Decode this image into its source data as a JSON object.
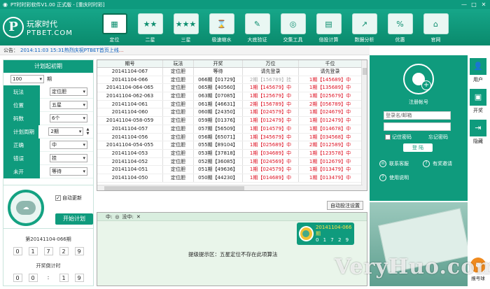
{
  "window": {
    "title": "PT时时彩软件V1.00 正式版 - [重庆时时彩]",
    "controls": [
      "—",
      "□",
      "✕"
    ]
  },
  "logo": {
    "mark": "P",
    "cn": "玩家时代",
    "en": "PTBET.COM"
  },
  "toolbar": [
    {
      "label": "定位",
      "icon": "▦"
    },
    {
      "label": "二星",
      "icon": "★★"
    },
    {
      "label": "三星",
      "icon": "★★★"
    },
    {
      "label": "极速缩水",
      "icon": "⌛"
    },
    {
      "label": "大底验证",
      "icon": "✎"
    },
    {
      "label": "交集工具",
      "icon": "◎"
    },
    {
      "label": "倍投计算",
      "icon": "▤"
    },
    {
      "label": "数据分析",
      "icon": "↗"
    },
    {
      "label": "优惠",
      "icon": "%"
    },
    {
      "label": "官网",
      "icon": "⌂"
    }
  ],
  "notice": {
    "prefix": "公告：",
    "message": "2014:11:03 15:31热烈庆祝PTBET首页上线",
    "link": "..."
  },
  "left": {
    "title": "计划起初期",
    "period_value": "100",
    "period_suffix": "期",
    "rows": [
      {
        "key": "玩法",
        "value": "定位胆"
      },
      {
        "key": "位置",
        "value": "五星"
      },
      {
        "key": "码数",
        "value": "6个"
      },
      {
        "key": "计划周期",
        "value": "2期"
      },
      {
        "key": "正确",
        "value": "中"
      },
      {
        "key": "错误",
        "value": "挂"
      },
      {
        "key": "未开",
        "value": "等待"
      }
    ],
    "auto_update": "自动更新",
    "auto_update_checked": "✓",
    "start_plan": "开始计划",
    "issue_label": "第20141104-066期",
    "issue_digits": [
      "0",
      "1",
      "7",
      "2",
      "9"
    ],
    "countdown_label": "开奖倒计时",
    "countdown_digits": [
      "0",
      "0",
      ":",
      "1",
      "9"
    ]
  },
  "table": {
    "headers": [
      "期号",
      "玩法",
      "开奖",
      "万位",
      "千位"
    ],
    "rows": [
      {
        "issue": "20141104-067",
        "play": "定位胆",
        "draw": "等待",
        "w": "请先登录",
        "q": "请先登录"
      },
      {
        "issue": "20141104-066",
        "play": "定位胆",
        "draw": "066期【01729】",
        "w": "2期【156789】挂",
        "q": "1期【145689】中"
      },
      {
        "issue": "20141104-064-065",
        "play": "定位胆",
        "draw": "065期【40560】",
        "w": "1期【145679】中",
        "q": "1期【135689】中"
      },
      {
        "issue": "20141104-062-063",
        "play": "定位胆",
        "draw": "063期【07085】",
        "w": "1期【125679】中",
        "q": "1期【025679】中"
      },
      {
        "issue": "20141104-061",
        "play": "定位胆",
        "draw": "061期【46631】",
        "w": "2期【156789】中",
        "q": "2期【056789】中"
      },
      {
        "issue": "20141104-060",
        "play": "定位胆",
        "draw": "060期【24350】",
        "w": "1期【024579】中",
        "q": "1期【024679】中"
      },
      {
        "issue": "20141104-058-059",
        "play": "定位胆",
        "draw": "059期【01376】",
        "w": "1期【012479】中",
        "q": "1期【012479】中"
      },
      {
        "issue": "20141104-057",
        "play": "定位胆",
        "draw": "057期【56509】",
        "w": "1期【014579】中",
        "q": "1期【014678】中"
      },
      {
        "issue": "20141104-056",
        "play": "定位胆",
        "draw": "056期【65071】",
        "w": "1期【345679】中",
        "q": "1期【034568】中"
      },
      {
        "issue": "20141104-054-055",
        "play": "定位胆",
        "draw": "055期【89104】",
        "w": "1期【025689】中",
        "q": "2期【012589】中"
      },
      {
        "issue": "20141104-053",
        "play": "定位胆",
        "draw": "053期【37818】",
        "w": "1期【034689】中",
        "q": "1期【123578】中"
      },
      {
        "issue": "20141104-052",
        "play": "定位胆",
        "draw": "052期【36085】",
        "w": "1期【024569】中",
        "q": "1期【012679】中"
      },
      {
        "issue": "20141104-051",
        "play": "定位胆",
        "draw": "051期【49636】",
        "w": "1期【024579】中",
        "q": "1期【013479】中"
      },
      {
        "issue": "20141104-050",
        "play": "定位胆",
        "draw": "050期【44230】",
        "w": "1期【014689】中",
        "q": "1期【013479】中"
      }
    ]
  },
  "auto_setting": "自动投注设置",
  "bottom": {
    "hit_label": "中:",
    "hit_icon": "◎",
    "miss_label": "没中:",
    "miss_icon": "✕",
    "message": "提级提示区：五星定位不存在此项算法",
    "mini_issue": "20141104-066期",
    "mini_digits": "0 1 7 2 9"
  },
  "login": {
    "register": "注册帐号",
    "username_placeholder": "登录名/邮箱",
    "remember": "记住密码",
    "forgot": "忘记密码",
    "login_button": "登 陆",
    "contact": "联系客服",
    "invite": "有奖邀请",
    "help": "使用说明"
  },
  "side": [
    {
      "label": "用户",
      "icon": "👤"
    },
    {
      "label": "开奖",
      "icon": "▣"
    },
    {
      "label": "隐藏",
      "icon": "⇥"
    }
  ],
  "baohao": {
    "label": "报号球",
    "icon": "●"
  },
  "watermark": "VeryHuo.com"
}
